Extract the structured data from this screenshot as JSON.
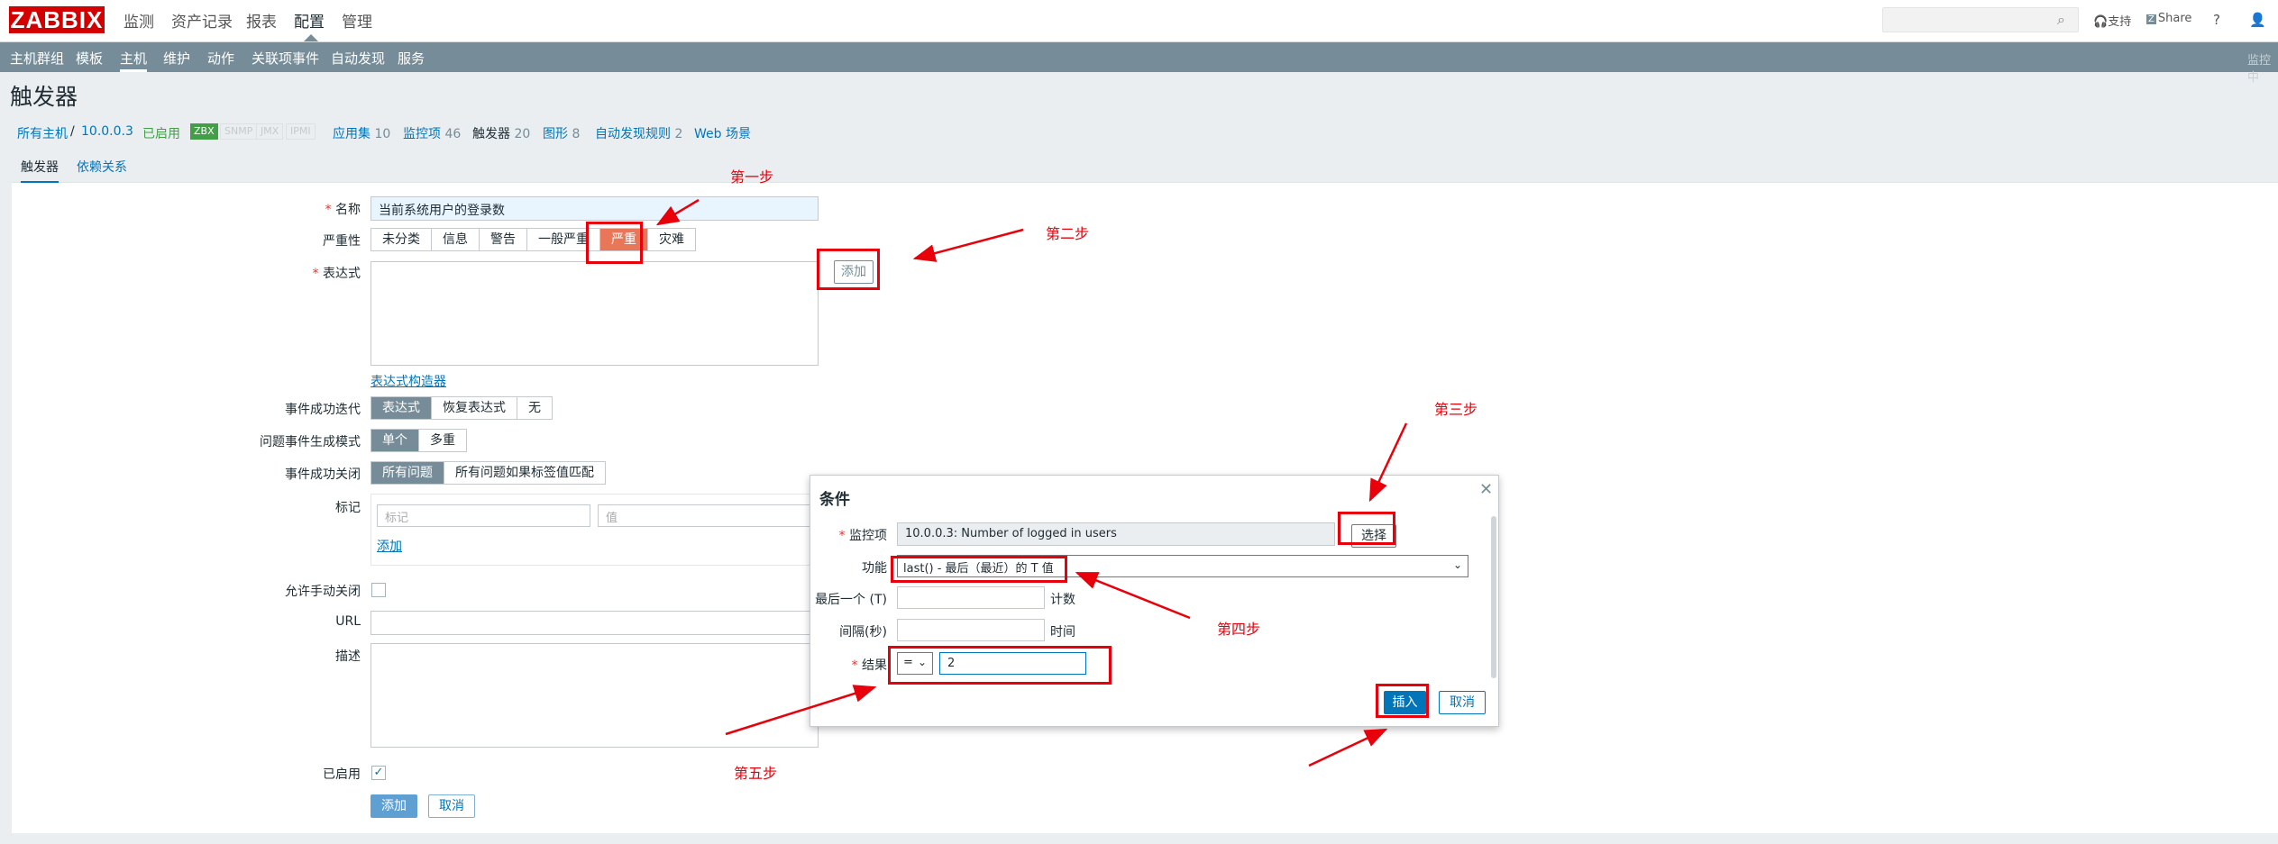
{
  "topbar": {
    "logo": "ZABBIX",
    "nav": [
      "监测",
      "资产记录",
      "报表",
      "配置",
      "管理"
    ],
    "support": "支持",
    "share": "Share",
    "help": "?"
  },
  "subnav": {
    "items": [
      "主机群组",
      "模板",
      "主机",
      "维护",
      "动作",
      "关联项事件",
      "自动发现",
      "服务"
    ],
    "right_text": "监控中"
  },
  "page_title": "触发器",
  "hostbar": {
    "all_hosts": "所有主机",
    "sep": "/",
    "host": "10.0.0.3",
    "status": "已启用",
    "badges": [
      "ZBX",
      "SNMP",
      "JMX",
      "IPMI"
    ],
    "links": [
      {
        "label": "应用集",
        "count": "10"
      },
      {
        "label": "监控项",
        "count": "46"
      },
      {
        "label": "触发器",
        "count": "20"
      },
      {
        "label": "图形",
        "count": "8"
      },
      {
        "label": "自动发现规则",
        "count": "2"
      },
      {
        "label": "Web 场景",
        "count": ""
      }
    ]
  },
  "tabs": [
    "触发器",
    "依赖关系"
  ],
  "form": {
    "name_label": "名称",
    "name_value": "当前系统用户的登录数",
    "severity_label": "严重性",
    "severity": [
      "未分类",
      "信息",
      "警告",
      "一般严重",
      "严重",
      "灾难"
    ],
    "expression_label": "表达式",
    "add_button": "添加",
    "expr_builder": "表达式构造器",
    "ok_event_label": "事件成功迭代",
    "ok_event_options": [
      "表达式",
      "恢复表达式",
      "无"
    ],
    "problem_mode_label": "问题事件生成模式",
    "problem_mode_options": [
      "单个",
      "多重"
    ],
    "ok_close_label": "事件成功关闭",
    "ok_close_options": [
      "所有问题",
      "所有问题如果标签值匹配"
    ],
    "tags_label": "标记",
    "tag_placeholder": "标记",
    "value_placeholder": "值",
    "tag_add": "添加",
    "manual_close_label": "允许手动关闭",
    "url_label": "URL",
    "desc_label": "描述",
    "enabled_label": "已启用",
    "submit": "添加",
    "cancel": "取消"
  },
  "dialog": {
    "title": "条件",
    "item_label": "监控项",
    "item_value": "10.0.0.3: Number of logged in users",
    "select_button": "选择",
    "function_label": "功能",
    "function_value": "last() - 最后（最近）的 T 值",
    "last_label": "最后一个 (T)",
    "last_unit": "计数",
    "interval_label": "间隔(秒)",
    "interval_unit": "时间",
    "result_label": "结果",
    "result_op": "=",
    "result_value": "2",
    "insert": "插入",
    "cancel": "取消"
  },
  "annotations": [
    "第一步",
    "第二步",
    "第三步",
    "第四步",
    "第五步"
  ],
  "colors": {
    "accent": "#0275b8",
    "annotation": "#e8000b",
    "subnav": "#768d99",
    "severity_high": "#e97659"
  }
}
